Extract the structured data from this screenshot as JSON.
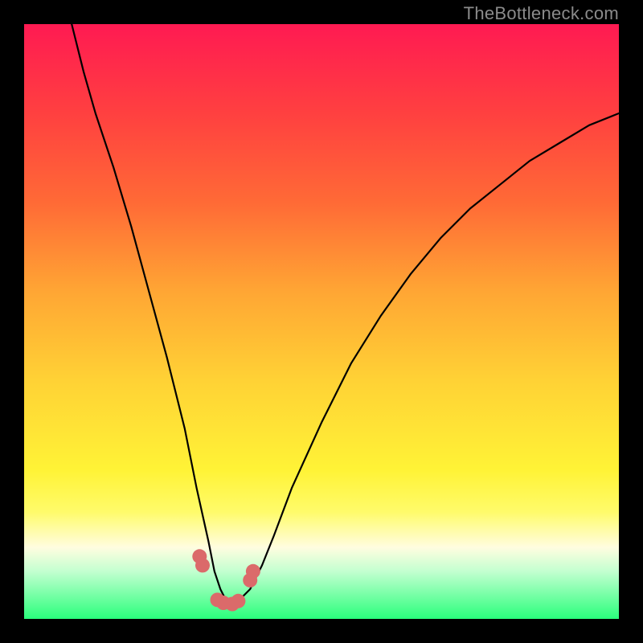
{
  "watermark": "TheBottleneck.com",
  "chart_data": {
    "type": "line",
    "title": "",
    "xlabel": "",
    "ylabel": "",
    "xlim": [
      0,
      100
    ],
    "ylim": [
      0,
      100
    ],
    "series": [
      {
        "name": "curve",
        "x": [
          8,
          10,
          12,
          15,
          18,
          21,
          24,
          27,
          29,
          31,
          32,
          33,
          34,
          35,
          36,
          38,
          40,
          42,
          45,
          50,
          55,
          60,
          65,
          70,
          75,
          80,
          85,
          90,
          95,
          100
        ],
        "values": [
          100,
          92,
          85,
          76,
          66,
          55,
          44,
          32,
          22,
          13,
          8,
          5,
          3,
          2.5,
          3,
          5,
          9,
          14,
          22,
          33,
          43,
          51,
          58,
          64,
          69,
          73,
          77,
          80,
          83,
          85
        ]
      }
    ],
    "markers": {
      "name": "highlight-dots",
      "color": "#db6a6a",
      "x": [
        29.5,
        30,
        32.5,
        33.5,
        35,
        36,
        38,
        38.5
      ],
      "values": [
        10.5,
        9,
        3.2,
        2.7,
        2.5,
        3,
        6.5,
        8
      ],
      "sizes": [
        9,
        9,
        9,
        9,
        9,
        9,
        9,
        9
      ]
    }
  }
}
